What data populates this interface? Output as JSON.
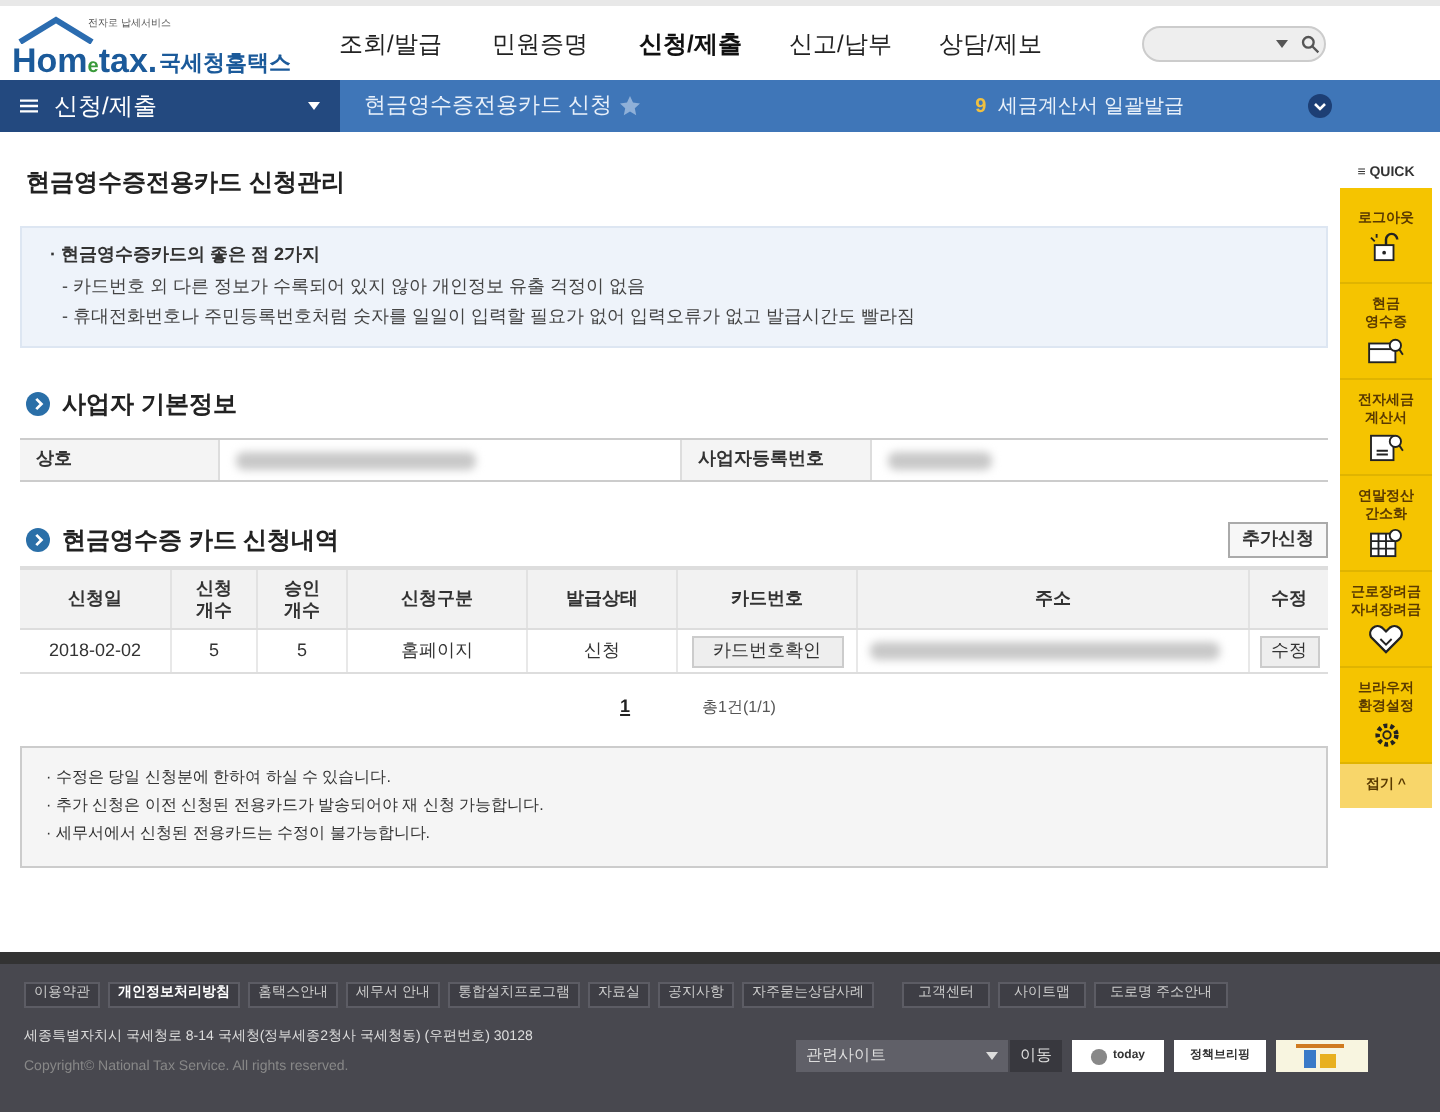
{
  "header": {
    "logo": {
      "tagline": "전자로 납세서비스",
      "brand_left": "Hom",
      "brand_e": "e",
      "brand_right": "tax.",
      "brand_kr": "국세청홈택스"
    },
    "menu": [
      {
        "label": "조회/발급",
        "selected": false
      },
      {
        "label": "민원증명",
        "selected": false
      },
      {
        "label": "신청/제출",
        "selected": true
      },
      {
        "label": "신고/납부",
        "selected": false
      },
      {
        "label": "상담/제보",
        "selected": false
      }
    ]
  },
  "nav_bar": {
    "section": "신청/제출",
    "page": "현금영수증전용카드 신청",
    "ticker_number": "9",
    "ticker_text": "세금계산서 일괄발급"
  },
  "title": "현금영수증전용카드 신청관리",
  "info_box": {
    "heading": "· 현금영수증카드의 좋은 점 2가지",
    "lines": [
      "- 카드번호 외 다른 정보가 수록되어 있지 않아 개인정보 유출 걱정이 없음",
      "- 휴대전화번호나 주민등록번호처럼 숫자를 일일이 입력할 필요가 없어 입력오류가 없고 발급시간도 빨라짐"
    ]
  },
  "business_info": {
    "heading": "사업자 기본정보",
    "fields": [
      {
        "label": "상호",
        "redacted": true
      },
      {
        "label": "사업자등록번호",
        "redacted": true
      }
    ]
  },
  "applications": {
    "heading": "현금영수증 카드 신청내역",
    "add_button": "추가신청",
    "table": {
      "columns": [
        "신청일",
        "신청\n개수",
        "승인\n개수",
        "신청구분",
        "발급상태",
        "카드번호",
        "주소",
        "수정"
      ],
      "rows": [
        {
          "date": "2018-02-02",
          "requested": "5",
          "approved": "5",
          "channel": "홈페이지",
          "status": "신청",
          "card_button": "카드번호확인",
          "address_redacted": true,
          "edit_button": "수정"
        }
      ]
    },
    "pagination": {
      "pages": [
        {
          "label": "1",
          "selected": true
        }
      ],
      "total": "총1건(1/1)"
    },
    "notes": [
      "· 수정은 당일 신청분에 한하여 하실 수 있습니다.",
      "· 추가 신청은 이전 신청된 전용카드가 발송되어야 재 신청 가능합니다.",
      "· 세무서에서 신청된 전용카드는 수정이 불가능합니다."
    ]
  },
  "quick": {
    "title": "≡ QUICK",
    "items": [
      {
        "label": "로그아웃",
        "kind": "lock"
      },
      {
        "label": "현금\n영수증",
        "kind": "receipt"
      },
      {
        "label": "전자세금\n계산서",
        "kind": "invoice"
      },
      {
        "label": "연말정산\n간소화",
        "kind": "table"
      },
      {
        "label": "근로장려금\n자녀장려금",
        "kind": "heart"
      },
      {
        "label": "브라우저\n환경설정",
        "kind": "gear"
      }
    ],
    "collapse": "접기 ^"
  },
  "footer": {
    "links": [
      {
        "label": "이용약관",
        "bold": false
      },
      {
        "label": "개인정보처리방침",
        "bold": true
      },
      {
        "label": "홈택스안내",
        "bold": false
      },
      {
        "label": "세무서 안내",
        "bold": false
      },
      {
        "label": "통합설치프로그램",
        "bold": false
      },
      {
        "label": "자료실",
        "bold": false
      },
      {
        "label": "공지사항",
        "bold": false
      },
      {
        "label": "자주묻는상담사례",
        "bold": false
      }
    ],
    "links_right": [
      "고객센터",
      "사이트맵",
      "도로명 주소안내"
    ],
    "address": "세종특별자치시 국세청로 8-14 국세청(정부세종2청사 국세청동) (우편번호) 30128",
    "copyright": "Copyright© National Tax Service. All rights reserved.",
    "related_select": "관련사이트",
    "go_button": "이동",
    "banners": [
      "today",
      "정책브리핑"
    ]
  }
}
